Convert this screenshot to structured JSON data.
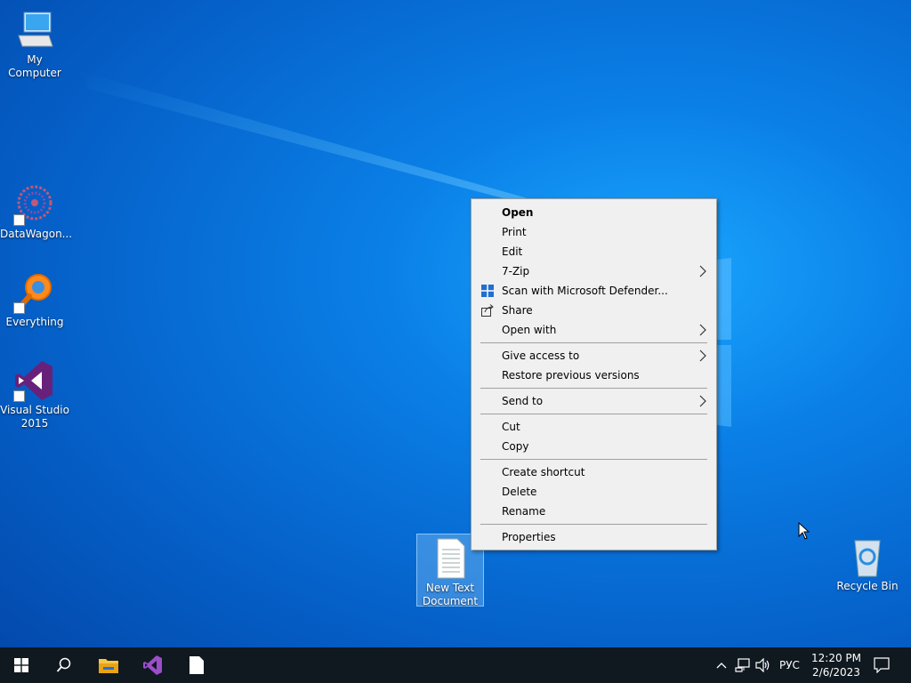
{
  "desktop": {
    "icons": [
      {
        "label": "My Computer"
      },
      {
        "label": "DataWagon..."
      },
      {
        "label": "Everything"
      },
      {
        "label": "Visual Studio 2015"
      },
      {
        "label": "New Text Document"
      },
      {
        "label": "Recycle Bin"
      }
    ]
  },
  "context_menu": {
    "items": [
      {
        "label": "Open"
      },
      {
        "label": "Print"
      },
      {
        "label": "Edit"
      },
      {
        "label": "7-Zip"
      },
      {
        "label": "Scan with Microsoft Defender..."
      },
      {
        "label": "Share"
      },
      {
        "label": "Open with"
      },
      {
        "label": "Give access to"
      },
      {
        "label": "Restore previous versions"
      },
      {
        "label": "Send to"
      },
      {
        "label": "Cut"
      },
      {
        "label": "Copy"
      },
      {
        "label": "Create shortcut"
      },
      {
        "label": "Delete"
      },
      {
        "label": "Rename"
      },
      {
        "label": "Properties"
      }
    ]
  },
  "taskbar": {
    "language": "РУС",
    "time": "12:20 PM",
    "date": "2/6/2023"
  },
  "colors": {
    "desktop_blue": "#0a7fe6",
    "taskbar": "#101820",
    "menu_bg": "#f0f0f0",
    "vs_purple": "#68217a"
  }
}
